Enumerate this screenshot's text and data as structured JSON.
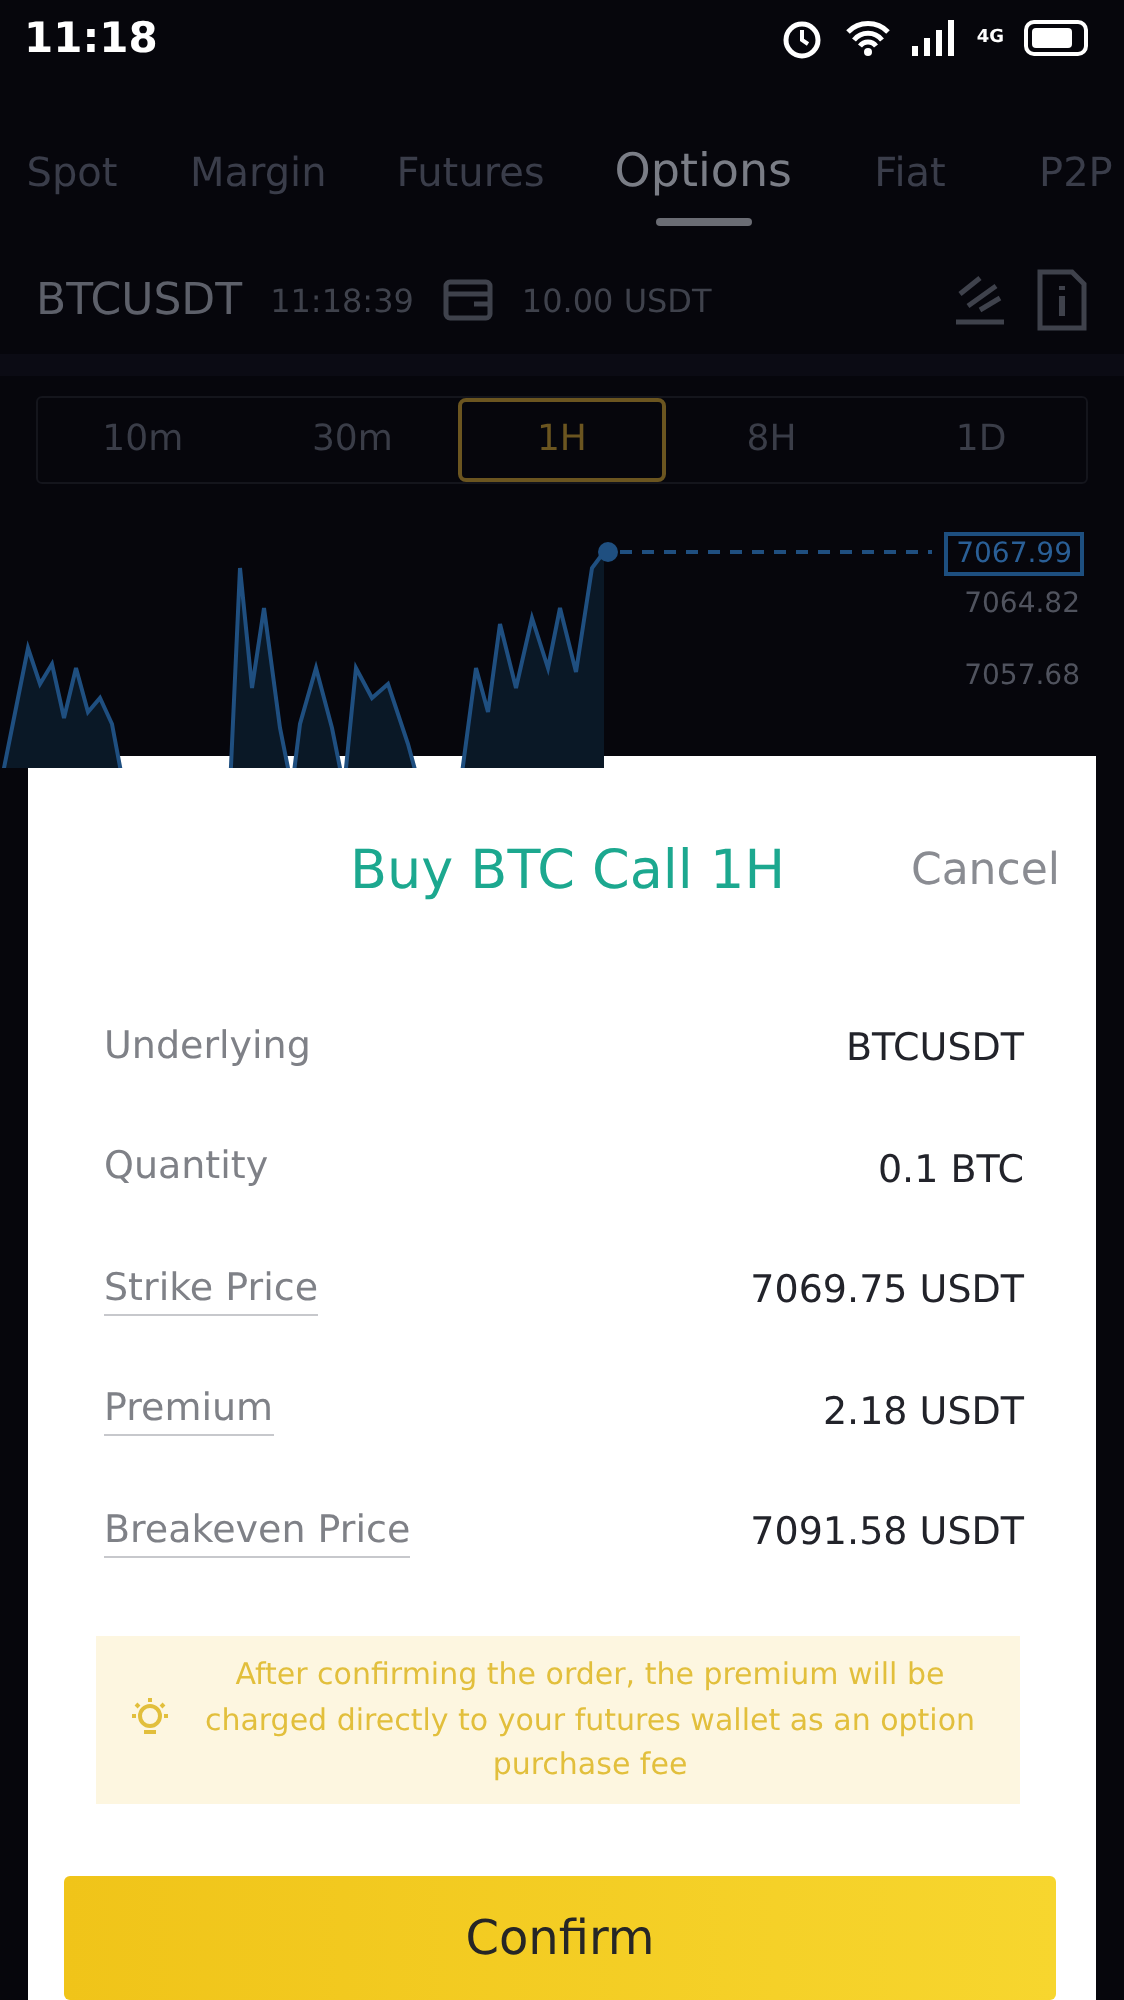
{
  "status_bar": {
    "time": "11:18",
    "network": "4G"
  },
  "market_tabs": [
    {
      "label": "Spot",
      "selected": false
    },
    {
      "label": "Margin",
      "selected": false
    },
    {
      "label": "Futures",
      "selected": false
    },
    {
      "label": "Options",
      "selected": true
    },
    {
      "label": "Fiat",
      "selected": false
    },
    {
      "label": "P2P",
      "selected": false
    }
  ],
  "ticker": {
    "symbol": "BTCUSDT",
    "time": "11:18:39",
    "balance": "10.00 USDT"
  },
  "intervals": [
    {
      "label": "10m",
      "selected": false
    },
    {
      "label": "30m",
      "selected": false
    },
    {
      "label": "1H",
      "selected": true
    },
    {
      "label": "8H",
      "selected": false
    },
    {
      "label": "1D",
      "selected": false
    }
  ],
  "chart": {
    "current_price": "7067.99",
    "axis_labels": [
      "7064.82",
      "7057.68"
    ]
  },
  "dialog": {
    "title": "Buy BTC Call 1H",
    "cancel": "Cancel",
    "rows": [
      {
        "label": "Underlying",
        "value": "BTCUSDT",
        "underlined": false
      },
      {
        "label": "Quantity",
        "value": "0.1 BTC",
        "underlined": false
      },
      {
        "label": "Strike Price",
        "value": "7069.75 USDT",
        "underlined": true
      },
      {
        "label": "Premium",
        "value": "2.18 USDT",
        "underlined": true
      },
      {
        "label": "Breakeven Price",
        "value": "7091.58 USDT",
        "underlined": true
      }
    ],
    "notice": "After confirming the order, the premium will be charged directly to your futures wallet as an option purchase fee",
    "confirm": "Confirm"
  }
}
